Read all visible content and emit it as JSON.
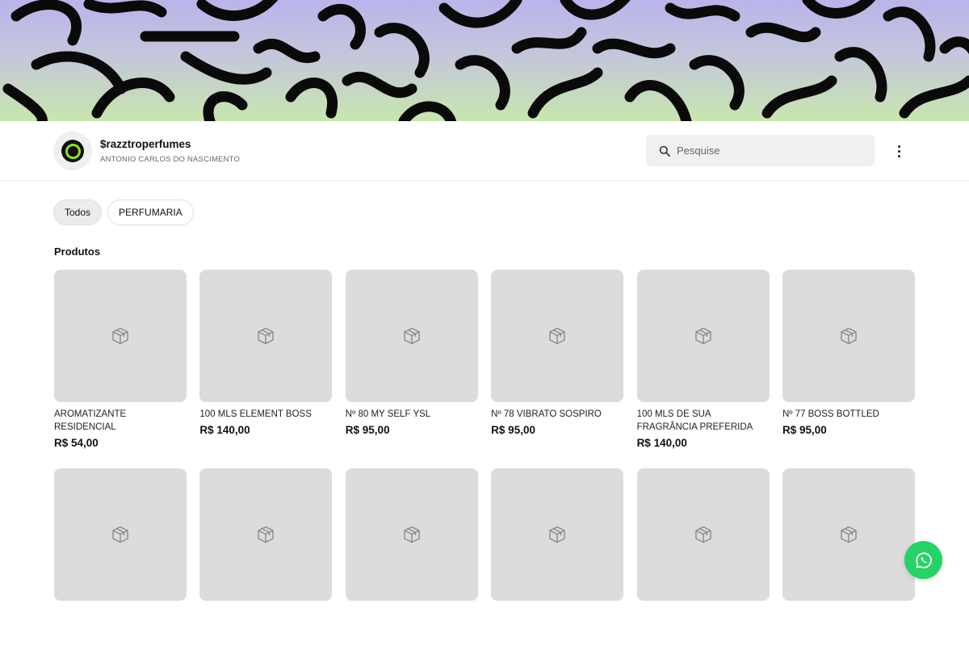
{
  "banner": {
    "gradient": [
      "#b9b4ea",
      "#c8e6ae"
    ],
    "pattern_icon": "squiggle-pattern"
  },
  "store": {
    "name": "$razztroperfumes",
    "owner": "ANTONIO CARLOS DO NASCIMENTO",
    "avatar_icon": "ring-logo-icon",
    "accent": "#8ee12f"
  },
  "search": {
    "placeholder": "Pesquise",
    "value": ""
  },
  "filters": [
    {
      "label": "Todos",
      "active": true
    },
    {
      "label": "PERFUMARIA",
      "active": false
    }
  ],
  "section": {
    "title": "Produtos"
  },
  "products": [
    {
      "name": "AROMATIZANTE RESIDENCIAL",
      "price": "R$ 54,00"
    },
    {
      "name": "100 MLS ELEMENT BOSS",
      "price": "R$ 140,00"
    },
    {
      "name": "Nº 80 MY SELF YSL",
      "price": "R$ 95,00"
    },
    {
      "name": "Nº 78 VIBRATO SOSPIRO",
      "price": "R$ 95,00"
    },
    {
      "name": "100 MLS DE SUA FRAGRÂNCIA PREFERIDA",
      "price": "R$ 140,00"
    },
    {
      "name": "Nº 77 BOSS BOTTLED",
      "price": "R$ 95,00"
    }
  ],
  "whatsapp": {
    "color": "#25d366",
    "icon": "whatsapp-icon"
  }
}
